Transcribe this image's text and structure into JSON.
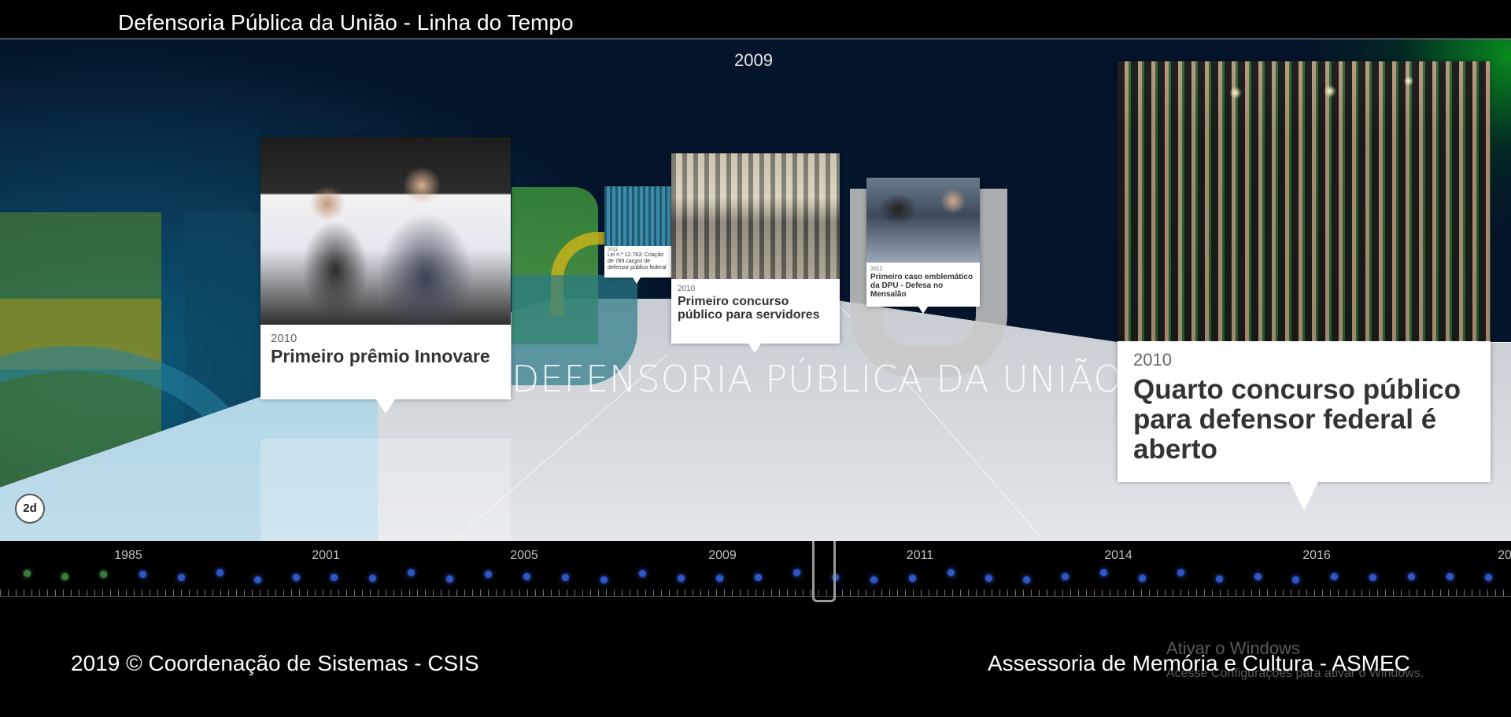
{
  "header": {
    "title": "Defensoria Pública da União - Linha do Tempo"
  },
  "stage": {
    "current_year": "2009",
    "logo_text": "DEFENSORIA PÚBLICA DA UNIÃO",
    "zoom_label": "2d"
  },
  "events": [
    {
      "year": "2010",
      "title": "Primeiro prêmio Innovare"
    },
    {
      "year": "2011",
      "title": "Lei n.º 12.763: Criação de 789 cargos de defensor público federal"
    },
    {
      "year": "2010",
      "title": "Primeiro concurso público para servidores"
    },
    {
      "year": "2012",
      "title": "Primeiro caso emblemático da DPU - Defesa no Mensalão"
    },
    {
      "year": "2010",
      "title": "Quarto concurso público para defensor federal é aberto"
    }
  ],
  "timeline": {
    "tick_labels": [
      "1985",
      "2001",
      "2005",
      "2009",
      "2011",
      "2014",
      "2016",
      "20"
    ]
  },
  "footer": {
    "left": "2019 © Coordenação de Sistemas - CSIS",
    "right": "Assessoria de Memória e Cultura - ASMEC"
  },
  "os_watermark": {
    "line1": "Ativar o Windows",
    "line2": "Acesse Configurações para ativar o Windows."
  },
  "colors": {
    "event_dot": "#2f57c8",
    "early_dot": "#3a7a3a",
    "background": "#000000",
    "card": "#ffffff"
  }
}
